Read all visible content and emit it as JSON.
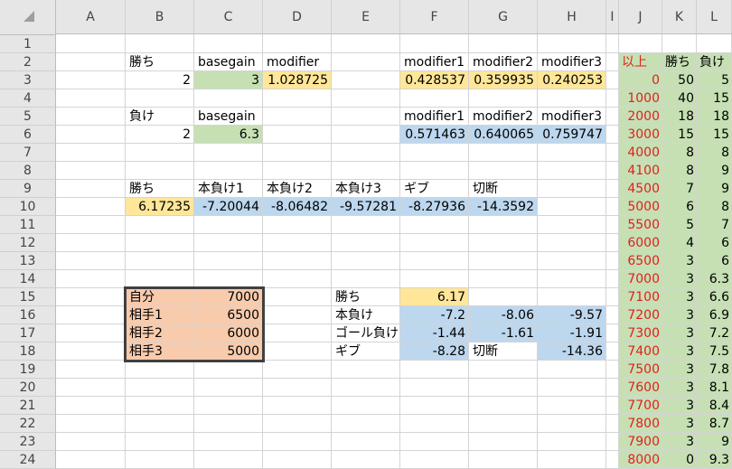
{
  "columns": [
    "A",
    "B",
    "C",
    "D",
    "E",
    "F",
    "G",
    "H",
    "I",
    "J",
    "K",
    "L"
  ],
  "rows": [
    "1",
    "2",
    "3",
    "4",
    "5",
    "6",
    "7",
    "8",
    "9",
    "10",
    "11",
    "12",
    "13",
    "14",
    "15",
    "16",
    "17",
    "18",
    "19",
    "20",
    "21",
    "22",
    "23",
    "24"
  ],
  "colors": {
    "green": "#c6e0b4",
    "yellow": "#ffe699",
    "blue": "#bdd7ee",
    "salmon": "#f8cbad",
    "header": "#e6e6e6",
    "grid": "#d4d4d4",
    "red_text": "#e02020"
  },
  "cells": {
    "B2": "勝ち",
    "C2": "basegain",
    "D2": "modifier",
    "F2": "modifier1",
    "G2": "modifier2",
    "H2": "modifier3",
    "B3": "2",
    "C3": "3",
    "D3": "1.028725",
    "F3": "0.428537",
    "G3": "0.359935",
    "H3": "0.240253",
    "B5": "負け",
    "C5": "basegain",
    "F5": "modifier1",
    "G5": "modifier2",
    "H5": "modifier3",
    "B6": "2",
    "C6": "6.3",
    "F6": "0.571463",
    "G6": "0.640065",
    "H6": "0.759747",
    "B9": "勝ち",
    "C9": "本負け1",
    "D9": "本負け2",
    "E9": "本負け3",
    "F9": "ギブ",
    "G9": "切断",
    "B10": "6.17235",
    "C10": "-7.20044",
    "D10": "-8.06482",
    "E10": "-9.57281",
    "F10": "-8.27936",
    "G10": "-14.3592",
    "B15": "自分",
    "C15": "7000",
    "B16": "相手1",
    "C16": "6500",
    "B17": "相手2",
    "C17": "6000",
    "B18": "相手3",
    "C18": "5000",
    "E15": "勝ち",
    "F15": "6.17",
    "E16": "本負け",
    "F16": "-7.2",
    "G16": "-8.06",
    "H16": "-9.57",
    "E17": "ゴール負け",
    "F17": "-1.44",
    "G17": "-1.61",
    "H17": "-1.91",
    "E18": "ギブ",
    "F18": "-8.28",
    "G18": "切断",
    "H18": "-14.36"
  },
  "right_table": {
    "headers": {
      "J": "以上",
      "K": "勝ち",
      "L": "負け"
    },
    "rows": [
      {
        "J": "0",
        "K": "50",
        "L": "5"
      },
      {
        "J": "1000",
        "K": "40",
        "L": "15"
      },
      {
        "J": "2000",
        "K": "18",
        "L": "18"
      },
      {
        "J": "3000",
        "K": "15",
        "L": "15"
      },
      {
        "J": "4000",
        "K": "8",
        "L": "8"
      },
      {
        "J": "4100",
        "K": "8",
        "L": "9"
      },
      {
        "J": "4500",
        "K": "7",
        "L": "9"
      },
      {
        "J": "5000",
        "K": "6",
        "L": "8"
      },
      {
        "J": "5500",
        "K": "5",
        "L": "7"
      },
      {
        "J": "6000",
        "K": "4",
        "L": "6"
      },
      {
        "J": "6500",
        "K": "3",
        "L": "6"
      },
      {
        "J": "7000",
        "K": "3",
        "L": "6.3"
      },
      {
        "J": "7100",
        "K": "3",
        "L": "6.6"
      },
      {
        "J": "7200",
        "K": "3",
        "L": "6.9"
      },
      {
        "J": "7300",
        "K": "3",
        "L": "7.2"
      },
      {
        "J": "7400",
        "K": "3",
        "L": "7.5"
      },
      {
        "J": "7500",
        "K": "3",
        "L": "7.8"
      },
      {
        "J": "7600",
        "K": "3",
        "L": "8.1"
      },
      {
        "J": "7700",
        "K": "3",
        "L": "8.4"
      },
      {
        "J": "7800",
        "K": "3",
        "L": "8.7"
      },
      {
        "J": "7900",
        "K": "3",
        "L": "9"
      },
      {
        "J": "8000",
        "K": "0",
        "L": "9.3"
      }
    ]
  }
}
